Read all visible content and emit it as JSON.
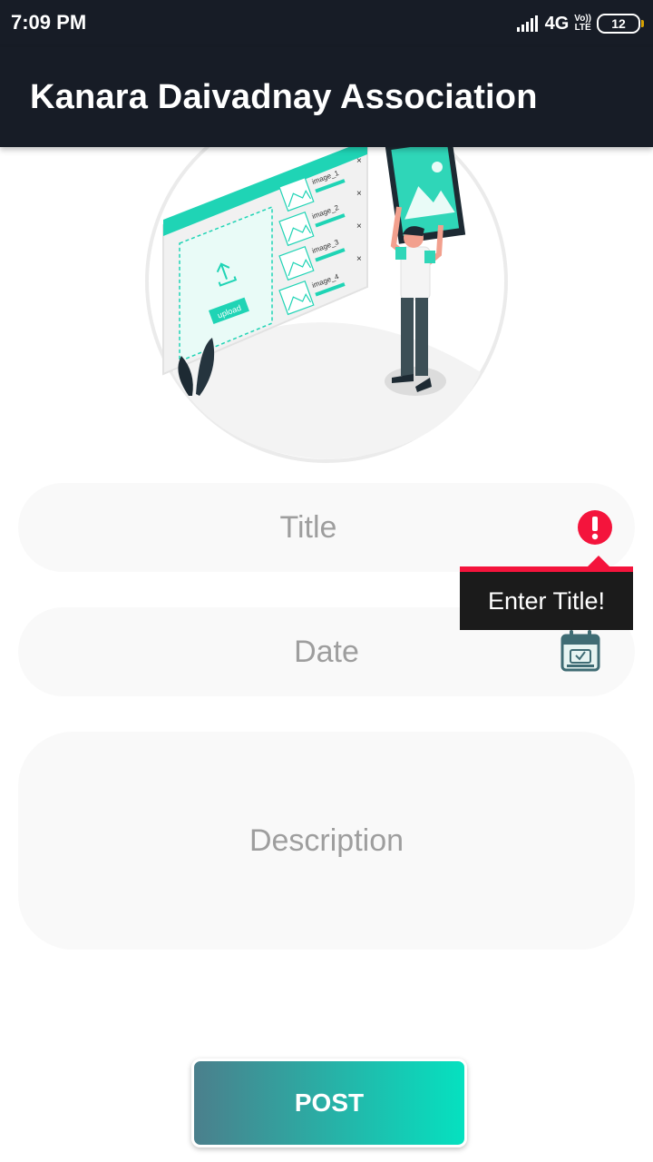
{
  "status_bar": {
    "time": "7:09 PM",
    "network": "4G",
    "volte_top": "Vo))",
    "volte_bottom": "LTE",
    "battery": "12"
  },
  "app_bar": {
    "title": "Kanara Daivadnay Association"
  },
  "illustration": {
    "upload_label": "upload",
    "image_labels": [
      "image_1",
      "image_2",
      "image_3",
      "image_4"
    ]
  },
  "form": {
    "title_placeholder": "Title",
    "date_placeholder": "Date",
    "description_placeholder": "Description",
    "title_error": "Enter Title!"
  },
  "post_button_label": "POST",
  "icons": {
    "signal": "signal-icon",
    "battery": "battery-icon",
    "error": "error-icon",
    "calendar": "calendar-icon"
  },
  "colors": {
    "app_bar": "#171c26",
    "accent": "#05e1c0",
    "error": "#f4143c",
    "field_bg": "#f9f9f9"
  }
}
